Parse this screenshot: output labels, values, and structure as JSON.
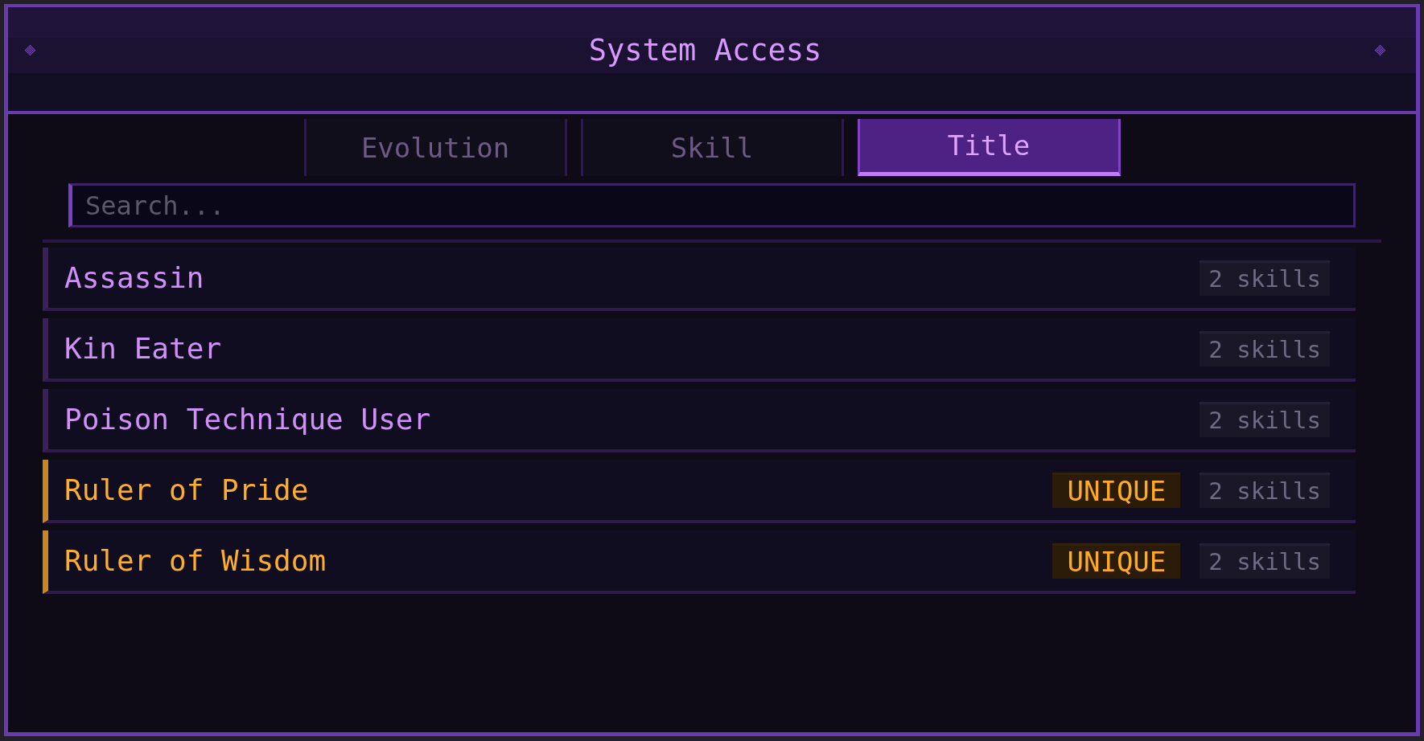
{
  "window": {
    "title": "System Access"
  },
  "tabs": [
    {
      "label": "Evolution",
      "selected": false
    },
    {
      "label": "Skill",
      "selected": false
    },
    {
      "label": "Title",
      "selected": true
    }
  ],
  "search": {
    "placeholder": "Search..."
  },
  "titles": [
    {
      "name": "Assassin",
      "unique": false,
      "skills": "2 skills"
    },
    {
      "name": "Kin Eater",
      "unique": false,
      "skills": "2 skills"
    },
    {
      "name": "Poison Technique User",
      "unique": false,
      "skills": "2 skills"
    },
    {
      "name": "Ruler of Pride",
      "unique": true,
      "badge": "UNIQUE",
      "skills": "2 skills"
    },
    {
      "name": "Ruler of Wisdom",
      "unique": true,
      "badge": "UNIQUE",
      "skills": "2 skills"
    }
  ]
}
